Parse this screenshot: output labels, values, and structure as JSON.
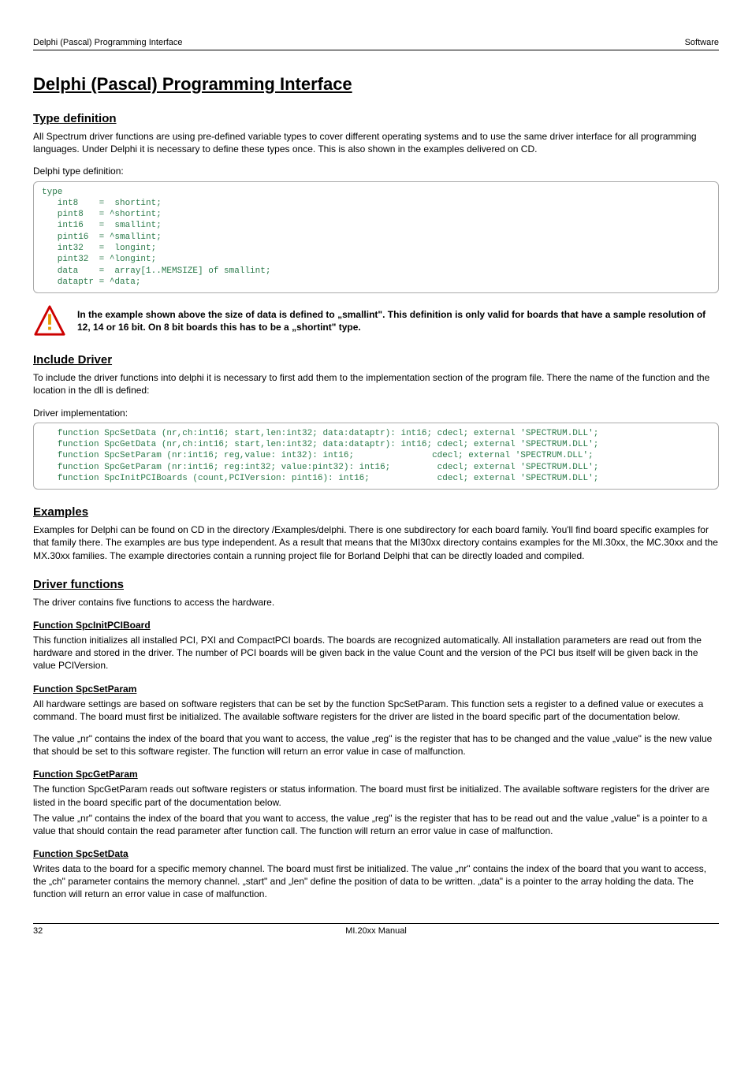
{
  "header": {
    "left": "Delphi (Pascal) Programming Interface",
    "right": "Software"
  },
  "title": "Delphi (Pascal) Programming Interface",
  "section_typedef": {
    "heading": "Type definition",
    "intro": "All Spectrum driver functions are using pre-defined variable types to cover different operating systems and to use the same driver interface for all programming languages. Under Delphi it is necessary to define these types once. This is also shown in the examples delivered on CD.",
    "label": "Delphi type definition:",
    "code": "type\n   int8    =  shortint;\n   pint8   = ^shortint;\n   int16   =  smallint;\n   pint16  = ^smallint;\n   int32   =  longint;\n   pint32  = ^longint;\n   data    =  array[1..MEMSIZE] of smallint;\n   dataptr = ^data;"
  },
  "warning": "In the example shown above the size of data is defined to „smallint\". This definition is only valid for boards that have a sample resolution of 12, 14 or 16 bit. On 8 bit boards this has to be a „shortint\" type.",
  "section_include": {
    "heading": "Include Driver",
    "intro": "To include the driver functions into delphi it is necessary to first add them to the implementation section of the program file. There the name of the function and the location in the dll is defined:",
    "label": "Driver implementation:",
    "code": "   function SpcSetData (nr,ch:int16; start,len:int32; data:dataptr): int16; cdecl; external 'SPECTRUM.DLL';\n   function SpcGetData (nr,ch:int16; start,len:int32; data:dataptr): int16; cdecl; external 'SPECTRUM.DLL';\n   function SpcSetParam (nr:int16; reg,value: int32): int16;               cdecl; external 'SPECTRUM.DLL';\n   function SpcGetParam (nr:int16; reg:int32; value:pint32): int16;         cdecl; external 'SPECTRUM.DLL';\n   function SpcInitPCIBoards (count,PCIVersion: pint16): int16;             cdecl; external 'SPECTRUM.DLL';"
  },
  "section_examples": {
    "heading": "Examples",
    "body": "Examples for Delphi can be found on CD in the directory /Examples/delphi. There is one subdirectory for each board family. You'll find board specific examples for that family there. The examples are bus type independent. As a result that means that the MI30xx directory contains examples for the MI.30xx, the MC.30xx and the MX.30xx families. The example directories contain a running project file for Borland Delphi that can be directly loaded and compiled."
  },
  "section_driver": {
    "heading": "Driver functions",
    "intro": "The driver contains five functions to access the hardware.",
    "fn1": {
      "heading": "Function SpcInitPCIBoard",
      "body": "This function initializes all installed PCI, PXI and CompactPCI boards. The boards are recognized automatically. All installation parameters are read out from the hardware and stored in the driver. The number of PCI boards will be given back in the value Count and the version of the PCI bus itself will be given back in the value PCIVersion."
    },
    "fn2": {
      "heading": "Function SpcSetParam",
      "body1": "All hardware settings are based on software registers that can be set by the function SpcSetParam. This function sets a register to a defined value or executes a command. The board must first be initialized. The available software  registers for the driver are listed in the board specific part of the documentation below.",
      "body2": "The value „nr\" contains the index of the board that you want to access, the value „reg\" is the register that has to be changed and the value „value\" is the new value that should be set to this software register. The function will return an error value in case of malfunction."
    },
    "fn3": {
      "heading": "Function SpcGetParam",
      "body1": "The function SpcGetParam reads out software registers or status information. The board must first be initialized. The available software  registers for the driver are listed in the board specific part of the documentation below.",
      "body2": "The value „nr\" contains the index of the board that you want to access, the value „reg\" is the register that has to be read out and the value „value\" is a pointer to a value that should contain the read parameter after function call. The function will return an error value in case of malfunction."
    },
    "fn4": {
      "heading": "Function SpcSetData",
      "body": "Writes data to the board for a specific memory channel. The board must first be initialized. The value „nr\" contains the index of the board that you want to access, the „ch\" parameter contains the memory channel. „start\" and „len\" define the position of data to be written. „data\" is a pointer to the array holding the data. The function will return an error value in case of malfunction."
    }
  },
  "footer": {
    "page": "32",
    "center": "MI.20xx Manual"
  }
}
